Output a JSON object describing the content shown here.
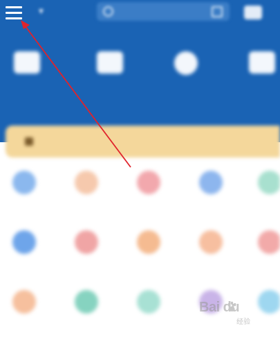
{
  "header": {
    "city": "",
    "search_placeholder": "",
    "quick_items": [
      {
        "label": "",
        "icon": "wallet-icon"
      },
      {
        "label": "",
        "icon": "card-icon"
      },
      {
        "label": "",
        "icon": "clock-icon"
      },
      {
        "label": "",
        "icon": "briefcase-icon"
      }
    ]
  },
  "banner": {
    "title": "",
    "more": ""
  },
  "grid": {
    "items": [
      {
        "label": "",
        "color": "#8bb8ee"
      },
      {
        "label": "",
        "color": "#f6c9ad"
      },
      {
        "label": "",
        "color": "#f2a8ad"
      },
      {
        "label": "",
        "color": "#8db6ee"
      },
      {
        "label": "",
        "color": "#a8e0cf"
      },
      {
        "label": "",
        "color": "#6ea5ea"
      },
      {
        "label": "",
        "color": "#f0a5a5"
      },
      {
        "label": "",
        "color": "#f5bb91"
      },
      {
        "label": "",
        "color": "#f7bfa0"
      },
      {
        "label": "",
        "color": "#f2aaa9"
      },
      {
        "label": "",
        "color": "#f6c09e"
      },
      {
        "label": "",
        "color": "#86d3c0"
      },
      {
        "label": "",
        "color": "#a8e1d4"
      },
      {
        "label": "",
        "color": "#c9b4e8"
      },
      {
        "label": "",
        "color": "#9ed7f0"
      }
    ]
  },
  "watermark": {
    "logo_text": "Bai du",
    "sub_text": "经验"
  },
  "colors": {
    "header_bg": "#1a63b4",
    "banner_bg": "#f4d79b",
    "arrow": "#e0232b"
  }
}
